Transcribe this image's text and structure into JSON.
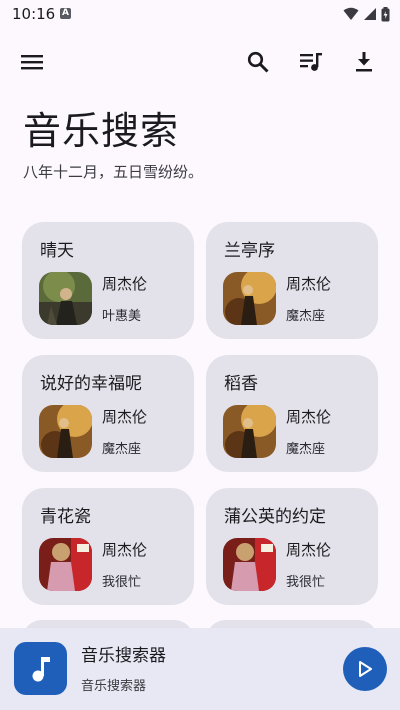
{
  "status": {
    "time": "10:16",
    "notif_glyph": "A"
  },
  "toolbar": {
    "icons": [
      "menu-icon",
      "search-icon",
      "queue-music-icon",
      "download-icon"
    ]
  },
  "header": {
    "title": "音乐搜索",
    "subtitle": "八年十二月，五日雪纷纷。"
  },
  "songs": [
    {
      "title": "晴天",
      "singer": "周杰伦",
      "album": "叶惠美"
    },
    {
      "title": "兰亭序",
      "singer": "周杰伦",
      "album": "魔杰座"
    },
    {
      "title": "说好的幸福呢",
      "singer": "周杰伦",
      "album": "魔杰座"
    },
    {
      "title": "稻香",
      "singer": "周杰伦",
      "album": "魔杰座"
    },
    {
      "title": "青花瓷",
      "singer": "周杰伦",
      "album": "我很忙"
    },
    {
      "title": "蒲公英的约定",
      "singer": "周杰伦",
      "album": "我很忙"
    }
  ],
  "player": {
    "title": "音乐搜索器",
    "subtitle": "音乐搜索器"
  },
  "colors": {
    "accent": "#1f5fba",
    "card_bg": "#e3e2ea",
    "background": "#fcf8fd",
    "player_bg": "#e7e8f3"
  }
}
